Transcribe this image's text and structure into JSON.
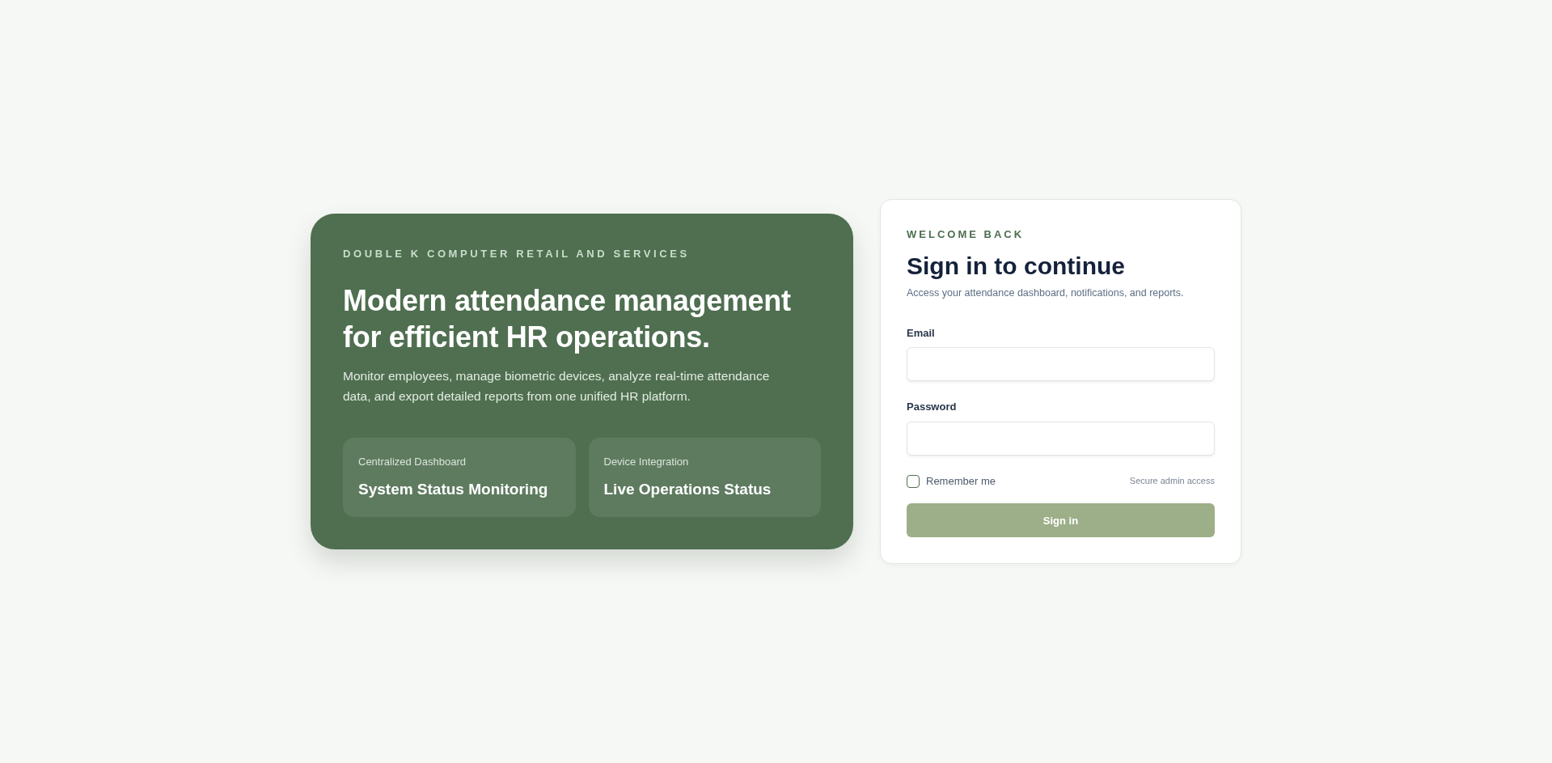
{
  "hero": {
    "brand": "DOUBLE K COMPUTER RETAIL AND SERVICES",
    "headline": "Modern attendance management for efficient HR operations.",
    "description": "Monitor employees, manage biometric devices, analyze real-time attendance data, and export detailed reports from one unified HR platform.",
    "features": [
      {
        "label": "Centralized Dashboard",
        "title": "System Status Monitoring"
      },
      {
        "label": "Device Integration",
        "title": "Live Operations Status"
      }
    ]
  },
  "login": {
    "eyebrow": "WELCOME BACK",
    "title": "Sign in to continue",
    "subtitle": "Access your attendance dashboard, notifications, and reports.",
    "fields": [
      {
        "label": "Email"
      },
      {
        "label": "Password"
      }
    ],
    "remember": {
      "label": "Remember me",
      "checked": false
    },
    "note": "Secure admin access",
    "submit": {
      "label": "Sign in",
      "disabled": true
    }
  }
}
